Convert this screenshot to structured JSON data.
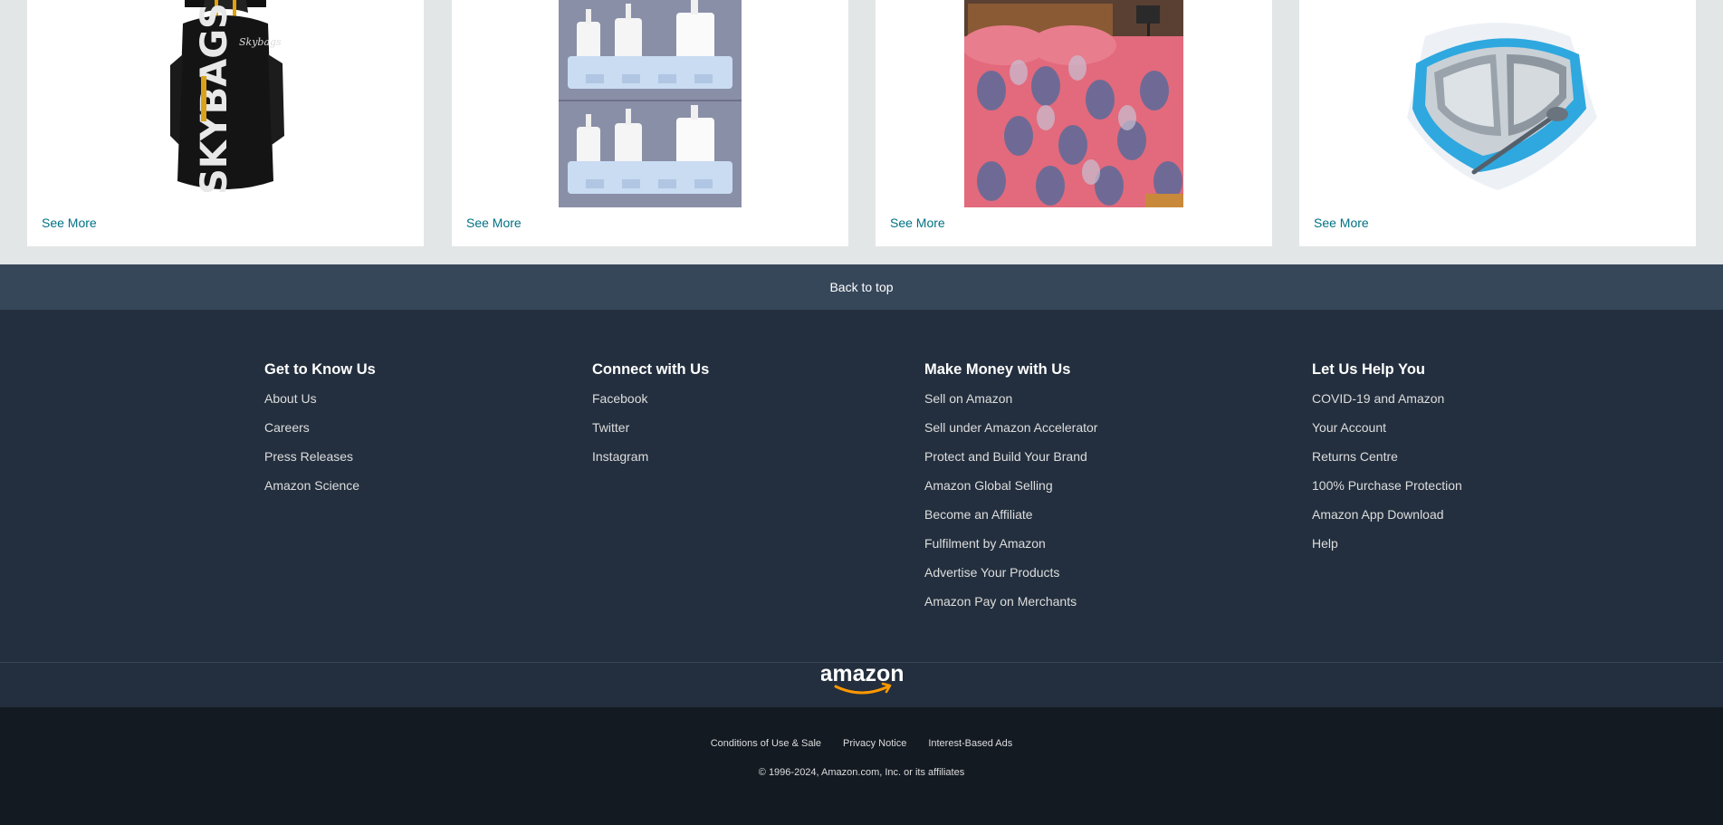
{
  "cards": [
    {
      "see_more": "See More",
      "image": "black-backpack-image",
      "image_text": "SKYBAGS"
    },
    {
      "see_more": "See More",
      "image": "bathroom-shelf-organizer-image"
    },
    {
      "see_more": "See More",
      "image": "pink-leaf-bedsheet-image"
    },
    {
      "see_more": "See More",
      "image": "steel-lunch-box-image"
    }
  ],
  "back_to_top": "Back to top",
  "footer": {
    "columns": [
      {
        "title": "Get to Know Us",
        "links": [
          "About Us",
          "Careers",
          "Press Releases",
          "Amazon Science"
        ]
      },
      {
        "title": "Connect with Us",
        "links": [
          "Facebook",
          "Twitter",
          "Instagram"
        ]
      },
      {
        "title": "Make Money with Us",
        "links": [
          "Sell on Amazon",
          "Sell under Amazon Accelerator",
          "Protect and Build Your Brand",
          "Amazon Global Selling",
          "Become an Affiliate",
          "Fulfilment by Amazon",
          "Advertise Your Products",
          "Amazon Pay on Merchants"
        ]
      },
      {
        "title": "Let Us Help You",
        "links": [
          "COVID-19 and Amazon",
          "Your Account",
          "Returns Centre",
          "100% Purchase Protection",
          "Amazon App Download",
          "Help"
        ]
      }
    ],
    "logo_text": "amazon",
    "legal_links": [
      "Conditions of Use & Sale",
      "Privacy Notice",
      "Interest-Based Ads"
    ],
    "copyright": "© 1996-2024, Amazon.com, Inc. or its affiliates"
  },
  "colors": {
    "link": "#007185",
    "back_to_top_bg": "#37475a",
    "footer_bg": "#232f3e",
    "footer_bottom_bg": "#131a22",
    "logo_arrow": "#ff9900"
  }
}
